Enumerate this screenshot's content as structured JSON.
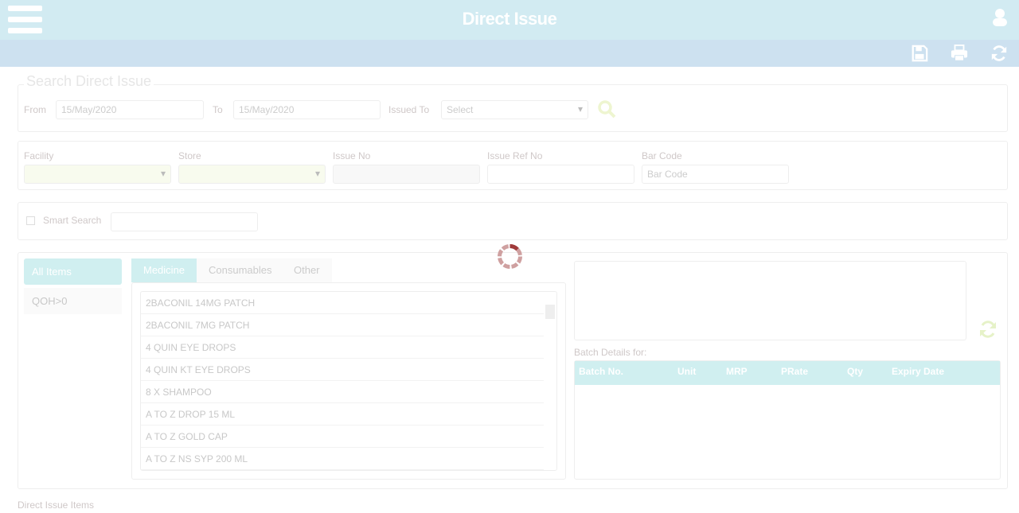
{
  "header": {
    "title": "Direct Issue"
  },
  "search": {
    "legend": "Search Direct Issue",
    "from_label": "From",
    "from_value": "15/May/2020",
    "to_label": "To",
    "to_value": "15/May/2020",
    "issued_to_label": "Issued To",
    "issued_to_value": "Select"
  },
  "filters": {
    "facility": "Facility",
    "store": "Store",
    "issue_no": "Issue No",
    "issue_ref_no": "Issue Ref No",
    "bar_code": "Bar Code",
    "bar_code_placeholder": "Bar Code"
  },
  "smart_search": {
    "label": "Smart Search"
  },
  "item_filters": [
    "All Items",
    "QOH>0"
  ],
  "tabs": [
    "Medicine",
    "Consumables",
    "Other"
  ],
  "items": [
    "2BACONIL 14MG PATCH",
    "2BACONIL 7MG PATCH",
    "4 QUIN EYE DROPS",
    "4 QUIN KT EYE DROPS",
    "8 X SHAMPOO",
    "A TO Z DROP 15 ML",
    "A TO Z GOLD CAP",
    "A TO Z NS SYP 200 ML"
  ],
  "batch": {
    "label": "Batch Details for:",
    "columns": [
      "Batch No.",
      "Unit",
      "MRP",
      "PRate",
      "Qty",
      "Expiry Date"
    ]
  },
  "footer": {
    "section": "Direct Issue Items"
  }
}
